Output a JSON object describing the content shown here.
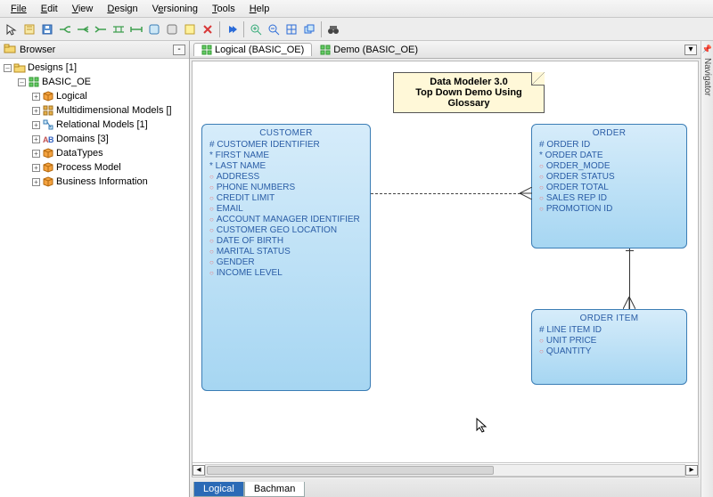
{
  "menu": {
    "items": [
      "File",
      "Edit",
      "View",
      "Design",
      "Versioning",
      "Tools",
      "Help"
    ]
  },
  "toolbar_icons": [
    "pointer",
    "new-model",
    "save",
    "h-layout",
    "h-layout-2",
    "h-layout-3",
    "h-layout-4",
    "h-layout-5",
    "entity-box",
    "view-box",
    "note-box",
    "delete",
    "play",
    "zoom-in",
    "zoom-out",
    "fit-window",
    "window",
    "binoculars"
  ],
  "browser": {
    "title": "Browser",
    "root": {
      "label": "Designs [1]"
    },
    "design": {
      "label": "BASIC_OE"
    },
    "children": [
      {
        "label": "Logical",
        "icon": "cube-orange"
      },
      {
        "label": "Multidimensional Models []",
        "icon": "grid"
      },
      {
        "label": "Relational Models [1]",
        "icon": "relational"
      },
      {
        "label": "Domains [3]",
        "icon": "domains"
      },
      {
        "label": "DataTypes",
        "icon": "cube-orange"
      },
      {
        "label": "Process Model",
        "icon": "cube-orange"
      },
      {
        "label": "Business Information",
        "icon": "cube-orange"
      }
    ]
  },
  "tabs": [
    {
      "label": "Logical (BASIC_OE)",
      "active": true,
      "icon": "grid-green"
    },
    {
      "label": "Demo (BASIC_OE)",
      "active": false,
      "icon": "grid-green"
    }
  ],
  "note": {
    "line1": "Data Modeler 3.0",
    "line2": "Top Down Demo Using Glossary"
  },
  "entities": {
    "customer": {
      "title": "CUSTOMER",
      "attrs": [
        {
          "m": "pk",
          "t": "CUSTOMER IDENTIFIER"
        },
        {
          "m": "req",
          "t": "FIRST NAME"
        },
        {
          "m": "req",
          "t": "LAST NAME"
        },
        {
          "m": "opt",
          "t": "ADDRESS"
        },
        {
          "m": "opt",
          "t": "PHONE NUMBERS"
        },
        {
          "m": "opt",
          "t": "CREDIT LIMIT"
        },
        {
          "m": "opt",
          "t": "EMAIL"
        },
        {
          "m": "opt",
          "t": "ACCOUNT MANAGER IDENTIFIER"
        },
        {
          "m": "opt",
          "t": "CUSTOMER GEO LOCATION"
        },
        {
          "m": "opt",
          "t": "DATE OF BIRTH"
        },
        {
          "m": "opt",
          "t": "MARITAL STATUS"
        },
        {
          "m": "opt",
          "t": "GENDER"
        },
        {
          "m": "opt",
          "t": "INCOME LEVEL"
        }
      ]
    },
    "order": {
      "title": "ORDER",
      "attrs": [
        {
          "m": "pk",
          "t": "ORDER ID"
        },
        {
          "m": "req",
          "t": "ORDER DATE"
        },
        {
          "m": "opt",
          "t": "ORDER_MODE"
        },
        {
          "m": "opt",
          "t": "ORDER STATUS"
        },
        {
          "m": "opt",
          "t": "ORDER TOTAL"
        },
        {
          "m": "opt",
          "t": "SALES REP ID"
        },
        {
          "m": "opt",
          "t": "PROMOTION ID"
        }
      ]
    },
    "order_item": {
      "title": "ORDER ITEM",
      "attrs": [
        {
          "m": "pk",
          "t": "LINE ITEM ID"
        },
        {
          "m": "opt",
          "t": "UNIT PRICE"
        },
        {
          "m": "opt",
          "t": "QUANTITY"
        }
      ]
    }
  },
  "bottom_tabs": [
    {
      "label": "Logical",
      "active": true
    },
    {
      "label": "Bachman",
      "active": false
    }
  ],
  "nav_panel": "Navigator"
}
